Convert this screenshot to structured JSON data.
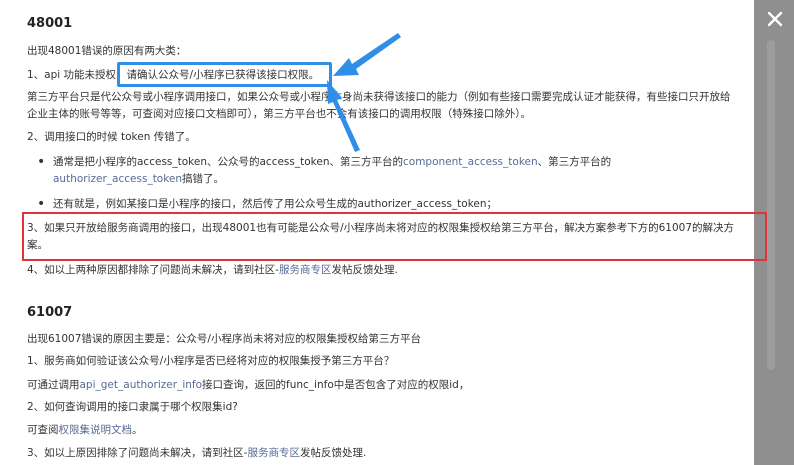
{
  "close_icon": "close-icon",
  "section1": {
    "title": "48001",
    "intro": "出现48001错误的原因有两大类：",
    "item1_prefix": "1、api 功能未授权",
    "item1_highlight": "，请确认公众号/小程序已获得该接口权限。",
    "item1_desc": "第三方平台只是代公众号或小程序调用接口，如果公众号或小程序本身尚未获得该接口的能力（例如有些接口需要完成认证才能获得，有些接口只开放给企业主体的账号等等，可查阅对应接口文档即可），第三方平台也不会有该接口的调用权限（特殊接口除外）。",
    "item2": "2、调用接口的时候 token 传错了。",
    "bullet1": {
      "a": "通常是把小程序的access_token、公众号的access_token、第三方平台的",
      "code1": "component_access_token",
      "b": "、第三方平台的",
      "code2": "authorizer_access_token",
      "c": "搞错了。"
    },
    "bullet2": "还有就是，例如某接口是小程序的接口，然后传了用公众号生成的authorizer_access_token；",
    "item3": "3、如果只开放给服务商调用的接口，出现48001也有可能是公众号/小程序尚未将对应的权限集授权给第三方平台，解决方案参考下方的61007的解决方案。",
    "item4_a": "4、如以上两种原因都排除了问题尚未解决，请到社区-",
    "item4_link": "服务商专区",
    "item4_b": "发帖反馈处理."
  },
  "section2": {
    "title": "61007",
    "intro": "出现61007错误的原因主要是：公众号/小程序尚未将对应的权限集授权给第三方平台",
    "q1": "1、服务商如何验证该公众号/小程序是否已经将对应的权限集授予第三方平台？",
    "a1_a": "可通过调用",
    "a1_link": "api_get_authorizer_info",
    "a1_b": "接口查询，返回的func_info中是否包含了对应的权限id，",
    "q2": "2、如何查询调用的接口隶属于哪个权限集id?",
    "a2_a": "可查阅",
    "a2_link": "权限集说明文档",
    "a2_b": "。",
    "q3_a": "3、如以上原因排除了问题尚未解决，请到社区-",
    "q3_link": "服务商专区",
    "q3_b": "发帖反馈处理."
  },
  "colors": {
    "link": "#576b95",
    "annotation_blue": "#2f8ee8",
    "annotation_red": "#e0343d",
    "overlay": "#8f8f8f"
  }
}
